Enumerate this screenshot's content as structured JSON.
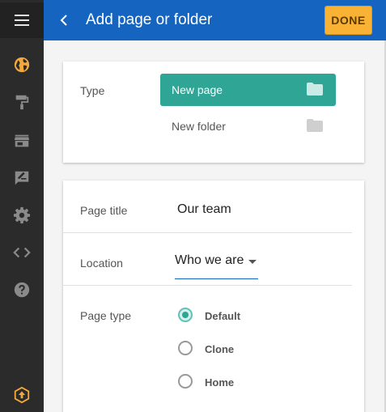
{
  "header": {
    "title": "Add page or folder",
    "done_label": "DONE"
  },
  "sidebar": {
    "items": [
      {
        "icon": "menu-icon"
      },
      {
        "icon": "globe-icon"
      },
      {
        "icon": "paint-roller-icon"
      },
      {
        "icon": "store-icon"
      },
      {
        "icon": "edit-note-icon"
      },
      {
        "icon": "gear-icon"
      },
      {
        "icon": "code-icon"
      },
      {
        "icon": "help-icon"
      },
      {
        "icon": "upload-hexagon-icon"
      }
    ]
  },
  "type_section": {
    "label": "Type",
    "options": [
      {
        "label": "New page",
        "selected": true
      },
      {
        "label": "New folder",
        "selected": false
      }
    ]
  },
  "form": {
    "page_title_label": "Page title",
    "page_title_value": "Our team",
    "location_label": "Location",
    "location_value": "Who we are",
    "page_type_label": "Page type",
    "page_types": [
      {
        "label": "Default",
        "checked": true
      },
      {
        "label": "Clone",
        "checked": false
      },
      {
        "label": "Home",
        "checked": false
      }
    ]
  },
  "colors": {
    "header": "#1565c0",
    "accent_teal": "#2fa595",
    "done_button": "#f9b233",
    "sidebar": "#2b2b2b",
    "active_icon": "#f2a83b"
  }
}
